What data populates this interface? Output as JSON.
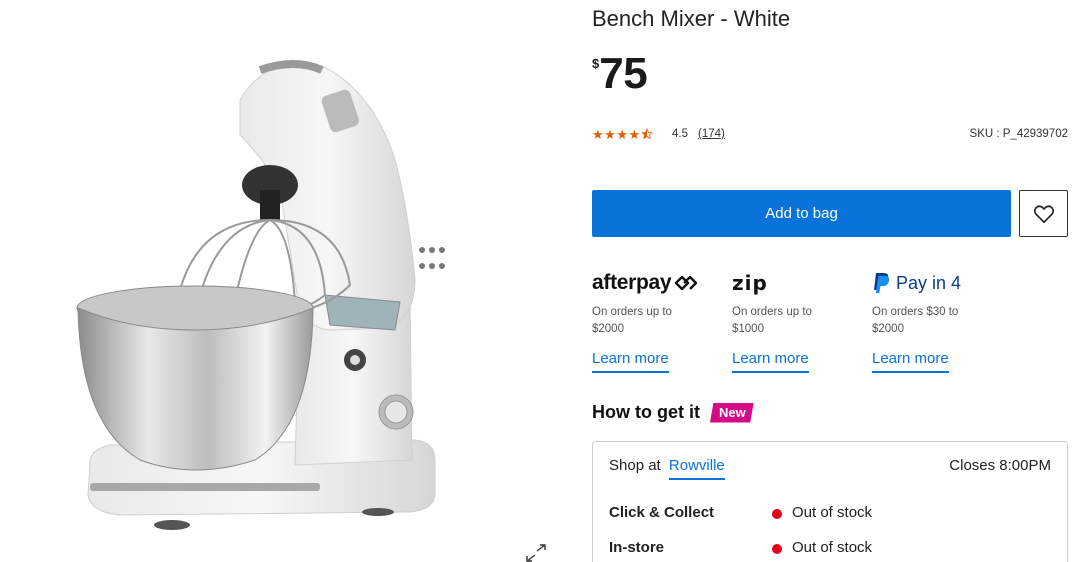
{
  "product": {
    "title": "Bench Mixer - White",
    "price_currency": "$",
    "price_amount": "75",
    "rating_value": "4.5",
    "rating_stars": 4.5,
    "rating_count": "(174)",
    "sku": "SKU : P_42939702"
  },
  "actions": {
    "add_to_bag": "Add to bag",
    "wishlist_icon": "heart-icon"
  },
  "payments": [
    {
      "provider": "afterpay",
      "logo_text": "afterpay",
      "desc": "On orders up to $2000",
      "link": "Learn more"
    },
    {
      "provider": "zip",
      "logo_text": "zip",
      "desc": "On orders up to $1000",
      "link": "Learn more"
    },
    {
      "provider": "paypal",
      "logo_text": "Pay in 4",
      "desc": "On orders $30 to $2000",
      "link": "Learn more"
    }
  ],
  "fulfilment": {
    "heading": "How to get it",
    "badge": "New",
    "shop_at": "Shop at",
    "store": "Rowville",
    "closes": "Closes 8:00PM",
    "options": [
      {
        "label": "Click & Collect",
        "status": "Out of stock"
      },
      {
        "label": "In-store",
        "status": "Out of stock"
      }
    ]
  },
  "colors": {
    "primary": "#0a73d9",
    "star": "#e65c00",
    "badge": "#d40a86",
    "out_of_stock": "#e3001b"
  }
}
